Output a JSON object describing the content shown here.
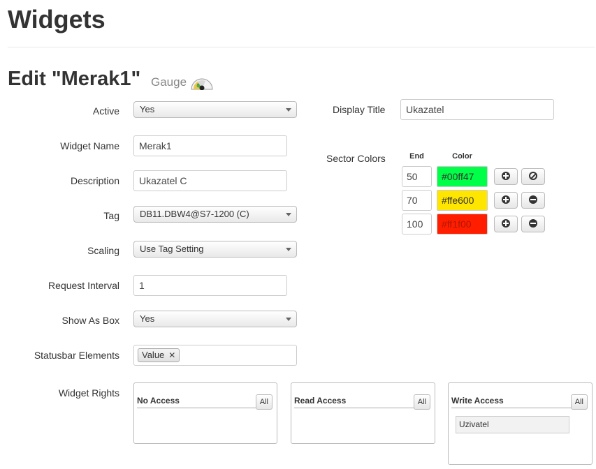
{
  "page": {
    "title": "Widgets"
  },
  "editor": {
    "heading": "Edit \"Merak1\"",
    "widget_type": "Gauge",
    "type_icon": "gauge-icon"
  },
  "fields": {
    "active": {
      "label": "Active",
      "value": "Yes"
    },
    "widget_name": {
      "label": "Widget Name",
      "value": "Merak1"
    },
    "description": {
      "label": "Description",
      "value": "Ukazatel C"
    },
    "tag": {
      "label": "Tag",
      "value": "DB11.DBW4@S7-1200 (C)"
    },
    "scaling": {
      "label": "Scaling",
      "value": "Use Tag Setting"
    },
    "request_interval": {
      "label": "Request Interval",
      "value": "1"
    },
    "show_as_box": {
      "label": "Show As Box",
      "value": "Yes"
    },
    "statusbar_elements": {
      "label": "Statusbar Elements",
      "chips": [
        "Value"
      ],
      "remove_glyph": "✕"
    },
    "widget_rights": {
      "label": "Widget Rights"
    },
    "display_title": {
      "label": "Display Title",
      "value": "Ukazatel"
    }
  },
  "sector_colors": {
    "label": "Sector Colors",
    "col_end": "End",
    "col_color": "Color",
    "rows": [
      {
        "end": "50",
        "color": "#00ff47",
        "text_color": "#333333"
      },
      {
        "end": "70",
        "color": "#ffe600",
        "text_color": "#333333"
      },
      {
        "end": "100",
        "color": "#ff1f00",
        "text_color": "#b01500"
      }
    ]
  },
  "rights": {
    "no_access": {
      "title": "No Access",
      "all_label": "All"
    },
    "read_access": {
      "title": "Read Access",
      "all_label": "All"
    },
    "write_access": {
      "title": "Write Access",
      "all_label": "All",
      "users": [
        "Uzivatel"
      ]
    }
  }
}
